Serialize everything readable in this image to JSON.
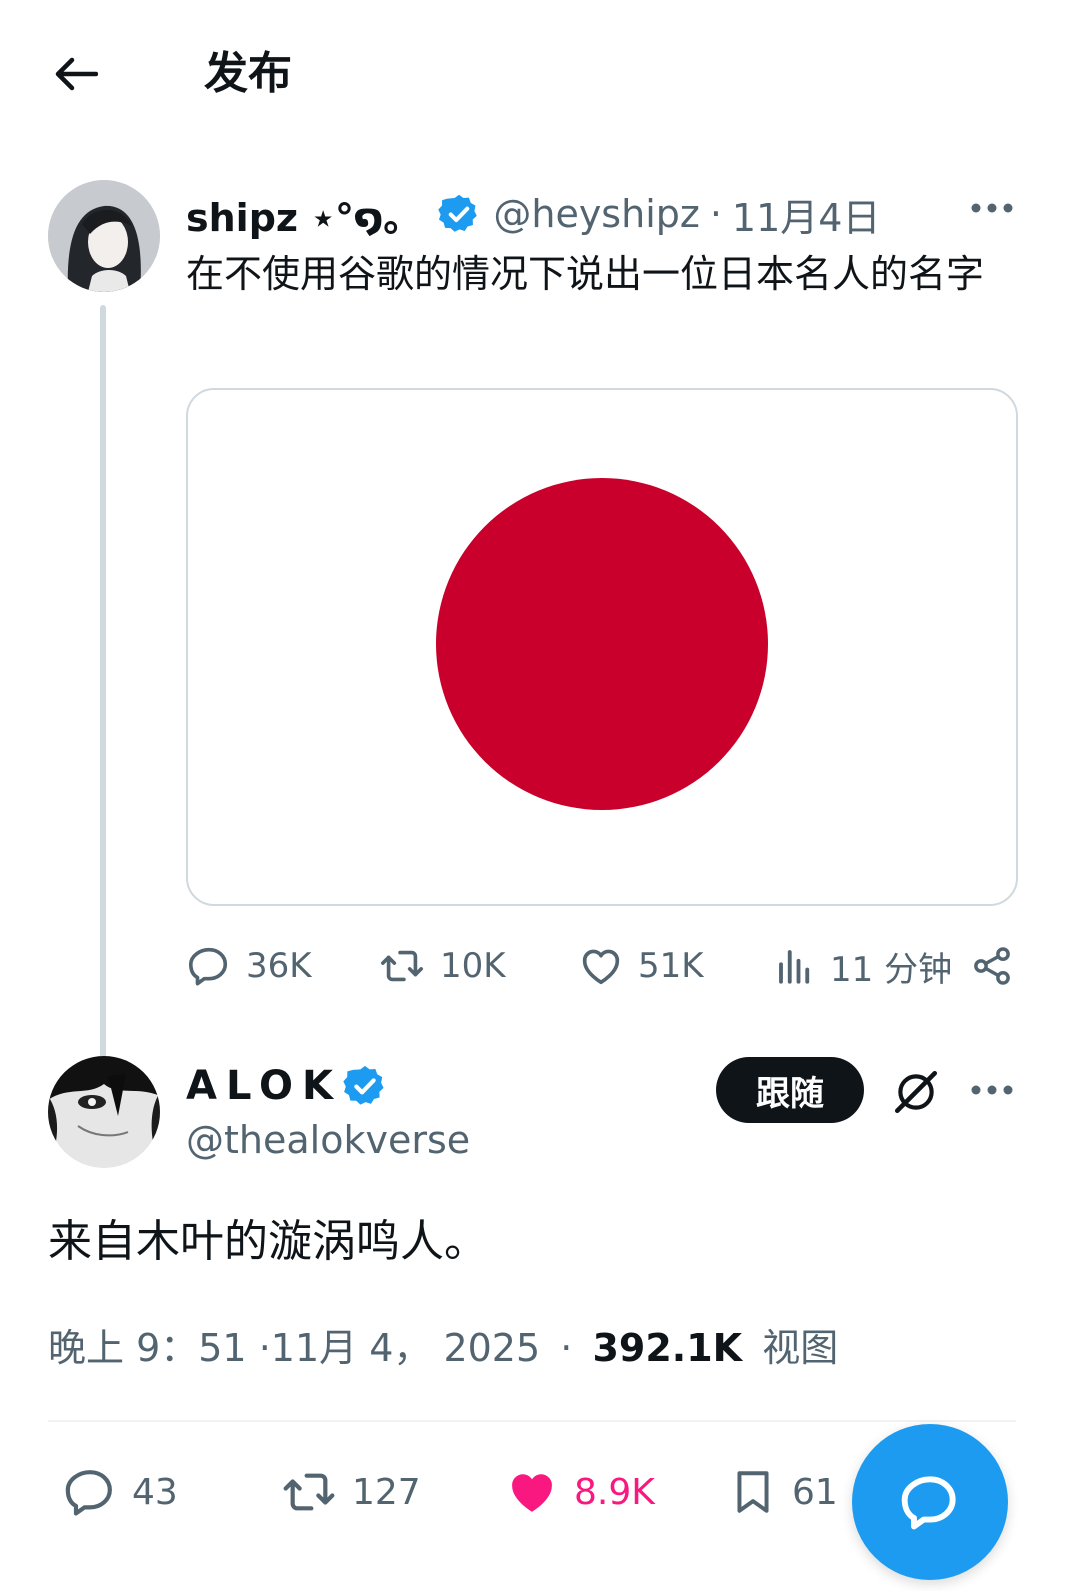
{
  "header": {
    "title": "发布"
  },
  "quoted_tweet": {
    "author_name": "shipz ⋆°໑。",
    "handle": "@heyshipz",
    "separator": "·",
    "date": "11月4日",
    "text": "在不使用谷歌的情况下说出一位日本名人的名字",
    "media_description_colors": {
      "background": "#ffffff",
      "disc": "#c8002b"
    },
    "stats": {
      "replies": "36K",
      "reposts": "10K",
      "likes": "51K",
      "views": "11 分钟"
    }
  },
  "main_tweet": {
    "author_name": "ALOK",
    "handle": "@thealokverse",
    "follow_label": "跟随",
    "text": "来自木叶的漩涡鸣人。",
    "meta": {
      "time_date": "晚上 9：51 ·11月 4， 2025",
      "separator": "·",
      "views_count": "392.1K",
      "views_label": "视图"
    },
    "stats": {
      "replies": "43",
      "reposts": "127",
      "likes": "8.9K",
      "bookmarks": "61"
    }
  },
  "colors": {
    "verified": "#1d9bf0",
    "like_active": "#f91880",
    "fab": "#1d9bf0",
    "muted_text": "#536471"
  }
}
